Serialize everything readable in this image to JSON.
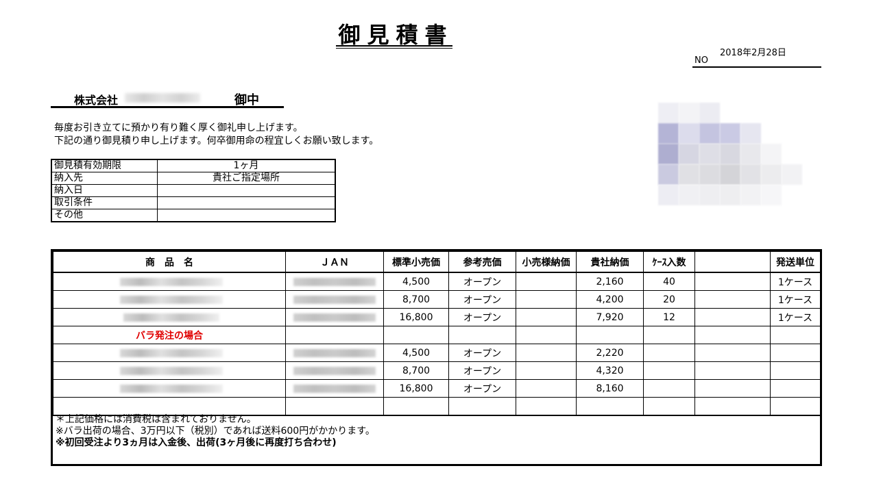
{
  "document": {
    "title": "御見積書",
    "no_label": "NO",
    "date": "2018年2月28日",
    "addressee": {
      "company_prefix": "株式会社",
      "honorific": "御中"
    },
    "greeting": [
      "毎度お引き立てに預かり有り難く厚く御礼申し上げます。",
      "下記の通り御見積り申し上げます。何卒御用命の程宜しくお願い致します。"
    ]
  },
  "terms": [
    {
      "label": "御見積有効期限",
      "value": "1ヶ月"
    },
    {
      "label": "納入先",
      "value": "貴社ご指定場所"
    },
    {
      "label": "納入日",
      "value": ""
    },
    {
      "label": "取引条件",
      "value": ""
    },
    {
      "label": "その他",
      "value": ""
    }
  ],
  "table": {
    "headers": [
      "商　品　名",
      "ＪＡＮ",
      "標準小売価",
      "参考売価",
      "小売様納価",
      "貴社納価",
      "ｹｰｽ入数",
      "",
      "発送単位"
    ],
    "rows": [
      {
        "price": "4,500",
        "ref": "オープン",
        "retail": "",
        "cost": "2,160",
        "case": "40",
        "extra": "",
        "unit": "1ケース"
      },
      {
        "price": "8,700",
        "ref": "オープン",
        "retail": "",
        "cost": "4,200",
        "case": "20",
        "extra": "",
        "unit": "1ケース"
      },
      {
        "price": "16,800",
        "ref": "オープン",
        "retail": "",
        "cost": "7,920",
        "case": "12",
        "extra": "",
        "unit": "1ケース"
      }
    ],
    "bara_label": "バラ発注の場合",
    "bara_rows": [
      {
        "price": "4,500",
        "ref": "オープン",
        "retail": "",
        "cost": "2,220",
        "case": "",
        "extra": "",
        "unit": ""
      },
      {
        "price": "8,700",
        "ref": "オープン",
        "retail": "",
        "cost": "4,320",
        "case": "",
        "extra": "",
        "unit": ""
      },
      {
        "price": "16,800",
        "ref": "オープン",
        "retail": "",
        "cost": "8,160",
        "case": "",
        "extra": "",
        "unit": ""
      }
    ]
  },
  "notes": [
    "＊上記価格には消費税は含まれておりません。",
    "※バラ出荷の場合、3万円以下（税別）であれば送料600円がかかります。",
    "※初回受注より3ヵ月は入金後、出荷(3ヶ月後に再度打ち合わせ)"
  ]
}
